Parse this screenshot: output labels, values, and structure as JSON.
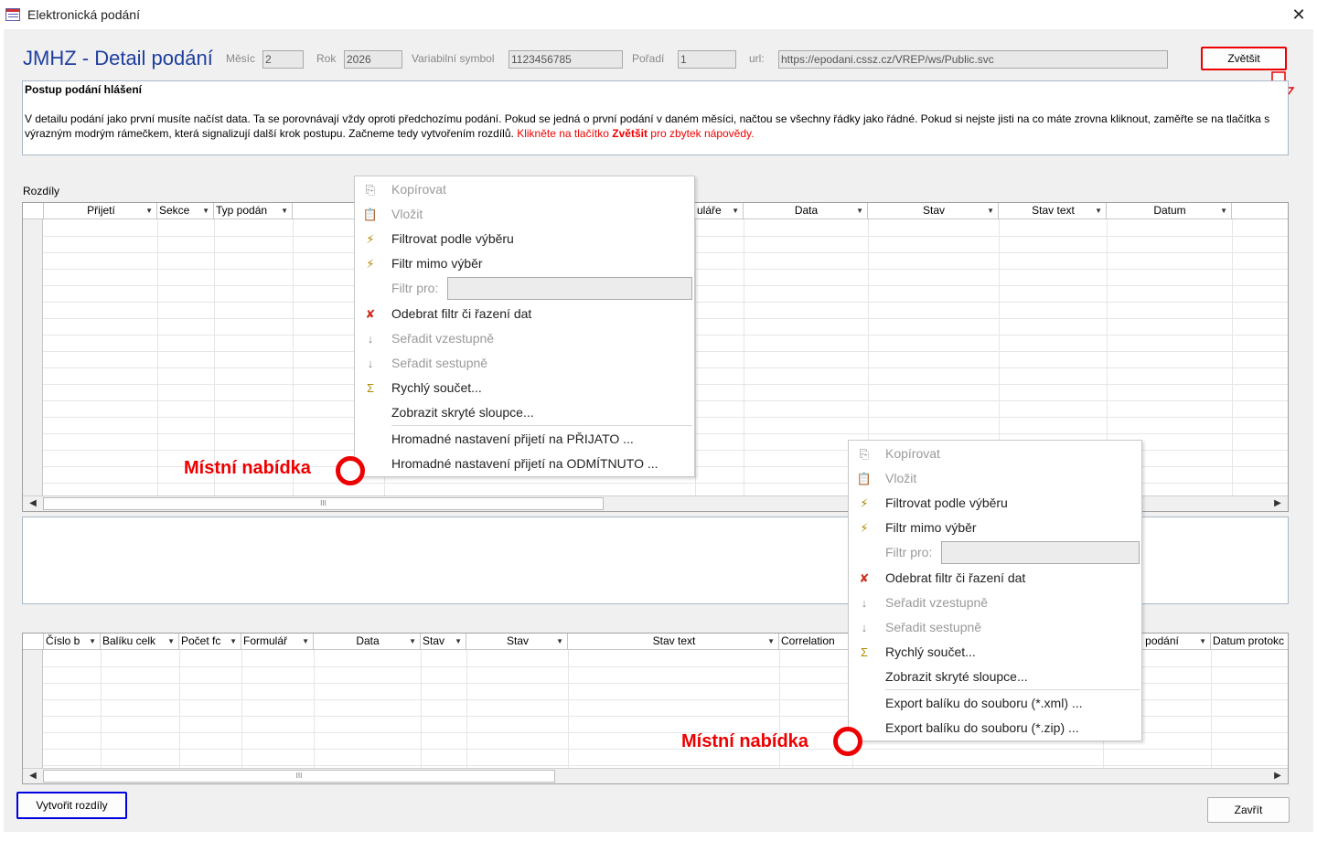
{
  "window": {
    "title": "Elektronická podání",
    "close_glyph": "✕"
  },
  "header": {
    "title": "JMHZ - Detail podání",
    "fields": {
      "mesic_label": "Měsíc",
      "mesic_value": "2",
      "rok_label": "Rok",
      "rok_value": "2026",
      "vs_label": "Variabilní symbol",
      "vs_value": "1123456785",
      "poradi_label": "Pořadí",
      "poradi_value": "1",
      "url_label": "url:",
      "url_value": "https://epodani.cssz.cz/VREP/ws/Public.svc"
    },
    "zoom_button": "Zvětšit"
  },
  "info": {
    "heading": "Postup podání hlášení",
    "text": " V detailu podání jako první musíte načíst data. Ta se porovnávají vždy oproti předchozímu podání. Pokud se jedná o první podání v daném měsíci, načtou se všechny řádky jako řádné. Pokud si nejste jisti na co máte zrovna kliknout, zaměřte se na tlačítka s výrazným modrým rámečkem, která signalizují další krok postupu. Začneme tedy vytvořením rozdílů. ",
    "red_a": "Klikněte na tlačítko ",
    "red_bold": "Zvětšit",
    "red_b": " pro zbytek nápovědy."
  },
  "diff_section": {
    "label": "Rozdíly",
    "columns": [
      "Přijetí",
      "Sekce",
      "Typ podán",
      "",
      "",
      "ulářе",
      "Data",
      "Stav",
      "Stav text",
      "Datum"
    ],
    "scroll_thumb": "III"
  },
  "packages_grid": {
    "columns": [
      "Číslo b",
      "Balíku celk",
      "Počet fc",
      "Formulář",
      "Data",
      "Stav",
      "Stav",
      "Stav text",
      "Correlation",
      "",
      "",
      "n podání",
      "Datum protokc"
    ],
    "scroll_thumb": "III"
  },
  "context_menu_1": {
    "items": [
      {
        "label": "Kopírovat",
        "icon": "copy-icon",
        "glyph": "⎘",
        "disabled": true
      },
      {
        "label": "Vložit",
        "icon": "paste-icon",
        "glyph": "📋",
        "disabled": true
      },
      {
        "label": "Filtrovat podle výběru",
        "icon": "filter-selection-icon",
        "glyph": "⚡",
        "disabled": false
      },
      {
        "label": "Filtr mimo výběr",
        "icon": "filter-exclude-icon",
        "glyph": "⚡",
        "disabled": false
      },
      {
        "label": "Filtr pro:",
        "icon": "",
        "glyph": "",
        "disabled": true
      },
      {
        "label": "Odebrat filtr či řazení dat",
        "icon": "remove-filter-icon",
        "glyph": "✘",
        "disabled": false
      },
      {
        "label": "Seřadit vzestupně",
        "icon": "sort-asc-icon",
        "glyph": "↓",
        "disabled": true
      },
      {
        "label": "Seřadit sestupně",
        "icon": "sort-desc-icon",
        "glyph": "↓",
        "disabled": true
      },
      {
        "label": "Rychlý součet...",
        "icon": "sum-icon",
        "glyph": "Σ",
        "disabled": false
      },
      {
        "label": "Zobrazit skryté sloupce...",
        "icon": "",
        "glyph": "",
        "disabled": false
      },
      {
        "label": "Hromadné nastavení přijetí na PŘIJATO ...",
        "icon": "",
        "glyph": "",
        "disabled": false
      },
      {
        "label": "Hromadné nastavení přijetí na ODMÍTNUTO ...",
        "icon": "",
        "glyph": "",
        "disabled": false
      }
    ]
  },
  "context_menu_2": {
    "items": [
      {
        "label": "Kopírovat",
        "icon": "copy-icon",
        "glyph": "⎘",
        "disabled": true
      },
      {
        "label": "Vložit",
        "icon": "paste-icon",
        "glyph": "📋",
        "disabled": true
      },
      {
        "label": "Filtrovat podle výběru",
        "icon": "filter-selection-icon",
        "glyph": "⚡",
        "disabled": false
      },
      {
        "label": "Filtr mimo výběr",
        "icon": "filter-exclude-icon",
        "glyph": "⚡",
        "disabled": false
      },
      {
        "label": "Filtr pro:",
        "icon": "",
        "glyph": "",
        "disabled": true
      },
      {
        "label": "Odebrat filtr či řazení dat",
        "icon": "remove-filter-icon",
        "glyph": "✘",
        "disabled": false
      },
      {
        "label": "Seřadit vzestupně",
        "icon": "sort-asc-icon",
        "glyph": "↓",
        "disabled": true
      },
      {
        "label": "Seřadit sestupně",
        "icon": "sort-desc-icon",
        "glyph": "↓",
        "disabled": true
      },
      {
        "label": "Rychlý součet...",
        "icon": "sum-icon",
        "glyph": "Σ",
        "disabled": false
      },
      {
        "label": "Zobrazit skryté sloupce...",
        "icon": "",
        "glyph": "",
        "disabled": false
      },
      {
        "label": "Export balíku do souboru (*.xml) ...",
        "icon": "",
        "glyph": "",
        "disabled": false
      },
      {
        "label": "Export balíku do souboru (*.zip) ...",
        "icon": "",
        "glyph": "",
        "disabled": false
      }
    ]
  },
  "annotations": {
    "context_menu_label": "Místní nabídka",
    "accent": "#e00000"
  },
  "footer": {
    "create_button": "Vytvořit rozdíly",
    "close_button": "Zavřít"
  }
}
